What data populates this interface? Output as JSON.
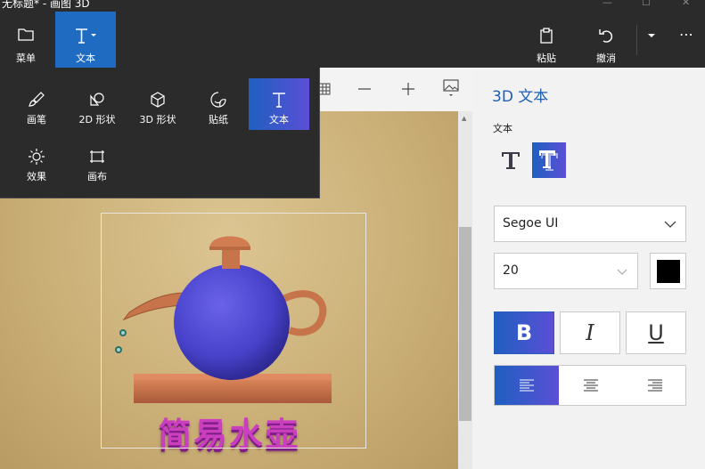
{
  "window": {
    "title": "无标题* - 画图 3D",
    "controls": {
      "minimize": "—",
      "maximize": "☐",
      "close": "✕"
    }
  },
  "toolbar": {
    "menu_label": "菜单",
    "text_label": "文本",
    "paste_label": "粘贴",
    "undo_label": "撤消",
    "more_label": "⋯"
  },
  "menu_panel": {
    "items": [
      {
        "label": "画笔",
        "icon": "brush-icon"
      },
      {
        "label": "2D 形状",
        "icon": "2d-shapes-icon"
      },
      {
        "label": "3D 形状",
        "icon": "3d-shapes-icon"
      },
      {
        "label": "贴纸",
        "icon": "stickers-icon"
      },
      {
        "label": "文本",
        "icon": "text-icon",
        "active": true
      },
      {
        "label": "效果",
        "icon": "effects-icon"
      },
      {
        "label": "画布",
        "icon": "canvas-icon"
      }
    ]
  },
  "canvas": {
    "art_text": "简易水壶"
  },
  "side_panel": {
    "title": "3D 文本",
    "text_label": "文本",
    "text_styles": [
      {
        "name": "2d-text",
        "selected": false
      },
      {
        "name": "3d-text",
        "selected": true
      }
    ],
    "font": "Segoe UI",
    "size": "20",
    "color": "#000000",
    "format": {
      "bold": "B",
      "italic": "I",
      "underline": "U",
      "bold_selected": true
    },
    "alignment": {
      "options": [
        "left",
        "center",
        "right"
      ],
      "selected": "left"
    }
  },
  "colors": {
    "accent": "#1f6bc2",
    "title_blue": "#1e5fb4",
    "dark_bg": "#2b2b2b",
    "text_3d": "#c93fbe",
    "teapot_body": "#4f4ad6",
    "teapot_wood": "#c7744a"
  }
}
